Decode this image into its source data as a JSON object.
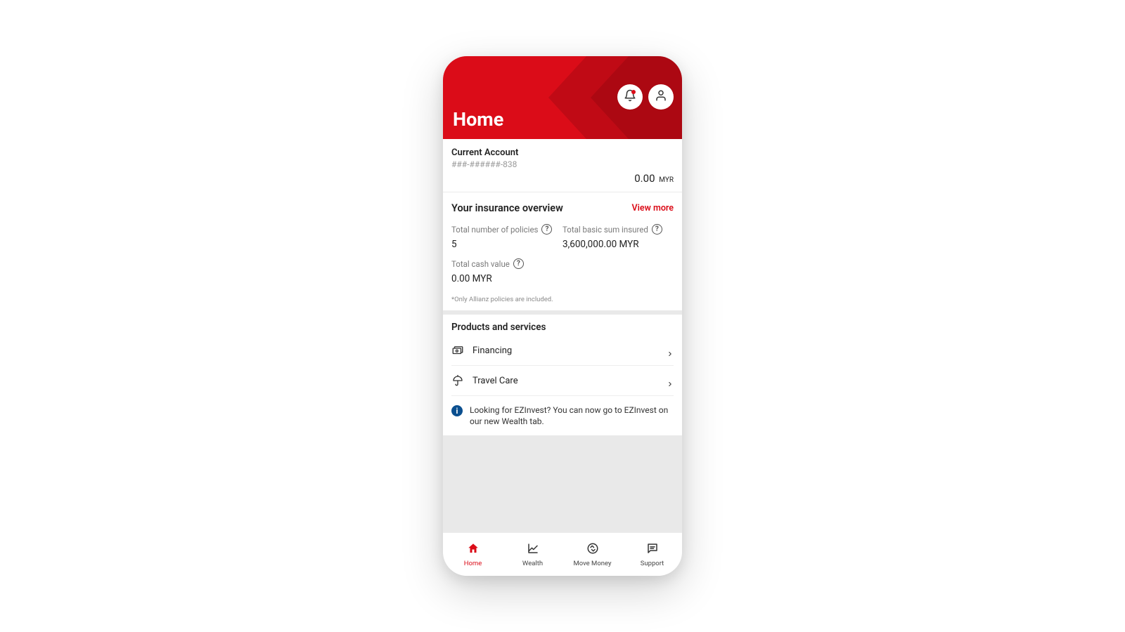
{
  "header": {
    "title": "Home"
  },
  "account": {
    "name": "Current Account",
    "number": "###-######-838",
    "balance_amount": "0.00",
    "balance_currency": "MYR"
  },
  "insurance": {
    "section_title": "Your insurance overview",
    "view_more_label": "View more",
    "metrics": {
      "policies_label": "Total number of policies",
      "policies_value": "5",
      "sum_insured_label": "Total basic sum insured",
      "sum_insured_value": "3,600,000.00 MYR",
      "cash_value_label": "Total cash value",
      "cash_value_value": "0.00 MYR"
    },
    "footnote": "*Only Allianz policies are included."
  },
  "products": {
    "section_title": "Products and services",
    "items": [
      {
        "label": "Financing"
      },
      {
        "label": "Travel Care"
      }
    ],
    "info_text": "Looking for EZInvest? You can now go to EZInvest on our new Wealth tab."
  },
  "tabs": {
    "home": "Home",
    "wealth": "Wealth",
    "move_money": "Move Money",
    "support": "Support"
  }
}
